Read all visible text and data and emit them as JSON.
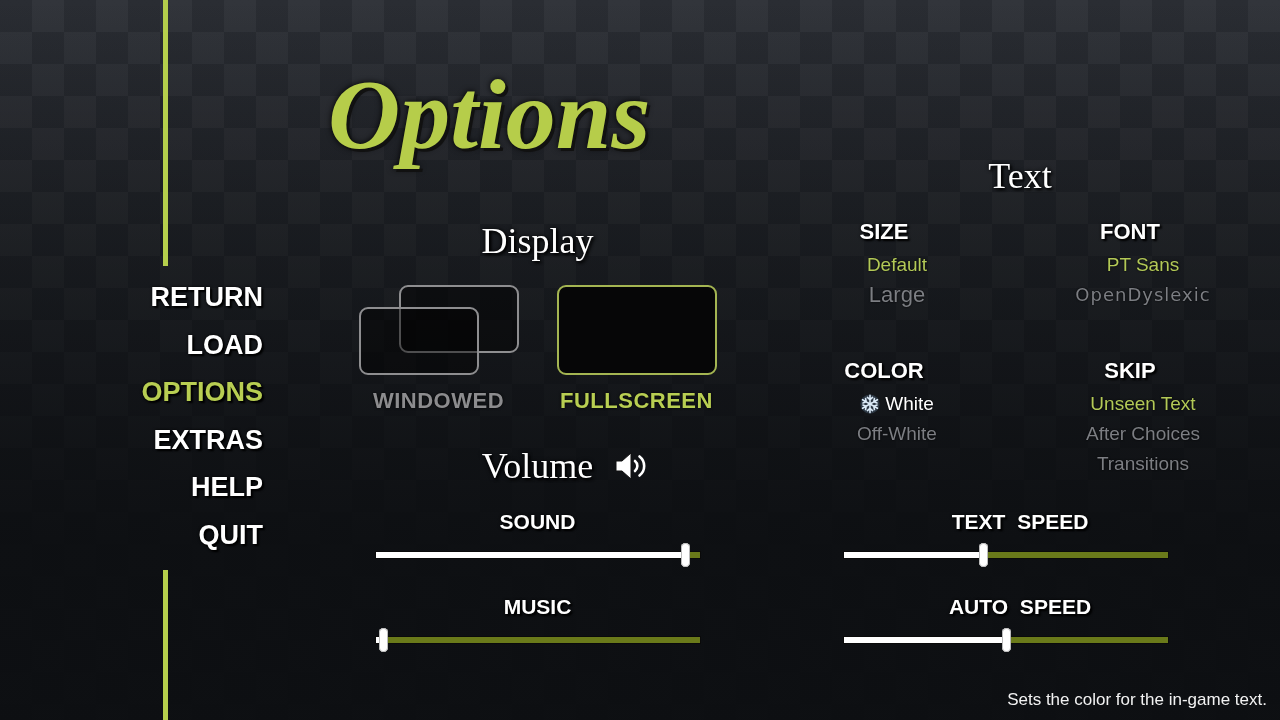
{
  "nav": {
    "items": [
      {
        "label": "RETURN",
        "selected": false
      },
      {
        "label": "LOAD",
        "selected": false
      },
      {
        "label": "OPTIONS",
        "selected": true
      },
      {
        "label": "EXTRAS",
        "selected": false
      },
      {
        "label": "HELP",
        "selected": false
      },
      {
        "label": "QUIT",
        "selected": false
      }
    ]
  },
  "title": "Options",
  "display": {
    "heading": "Display",
    "modes": [
      {
        "kind": "windowed",
        "label": "WINDOWED",
        "selected": false
      },
      {
        "kind": "fullscreen",
        "label": "FULLSCREEN",
        "selected": true
      }
    ]
  },
  "volume": {
    "heading": "Volume",
    "sliders": [
      {
        "label": "SOUND",
        "level": 0.97
      },
      {
        "label": "MUSIC",
        "level": 0.01
      }
    ]
  },
  "text": {
    "heading": "Text",
    "groups": [
      {
        "heading": "SIZE",
        "options": [
          {
            "label": "Default",
            "kind": "plain",
            "selected": true,
            "hovered": false
          },
          {
            "label": "Large",
            "kind": "large",
            "selected": false,
            "hovered": false
          }
        ]
      },
      {
        "heading": "FONT",
        "options": [
          {
            "label": "PT Sans",
            "kind": "plain",
            "selected": true,
            "hovered": false
          },
          {
            "label": "OpenDyslexic",
            "kind": "dyslexic",
            "selected": false,
            "hovered": false
          }
        ]
      },
      {
        "heading": "COLOR",
        "options": [
          {
            "label": "White",
            "kind": "plain",
            "selected": true,
            "hovered": true
          },
          {
            "label": "Off-White",
            "kind": "plain",
            "selected": false,
            "hovered": false
          }
        ]
      },
      {
        "heading": "SKIP",
        "options": [
          {
            "label": "Unseen Text",
            "kind": "plain",
            "selected": true,
            "hovered": false
          },
          {
            "label": "After Choices",
            "kind": "plain",
            "selected": false,
            "hovered": false
          },
          {
            "label": "Transitions",
            "kind": "plain",
            "selected": false,
            "hovered": false
          }
        ]
      }
    ],
    "sliders": [
      {
        "label": "TEXT SPEED",
        "level": 0.43
      },
      {
        "label": "AUTO SPEED",
        "level": 0.5
      }
    ]
  },
  "tooltip": "Sets the color for the in-game text."
}
